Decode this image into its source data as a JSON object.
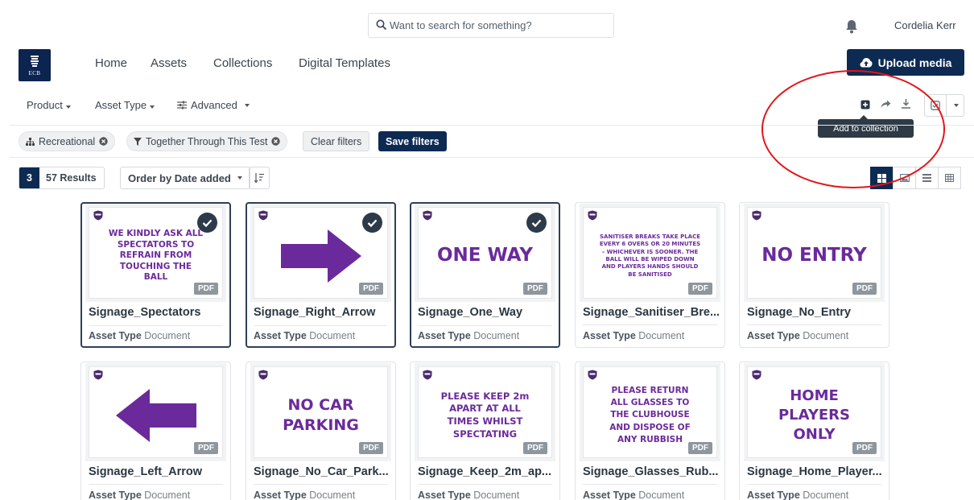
{
  "header": {
    "search_placeholder": "Want to search for something?",
    "user_name": "Cordelia Kerr"
  },
  "logo": {
    "text": "ECB"
  },
  "nav": {
    "items": [
      "Home",
      "Assets",
      "Collections",
      "Digital Templates"
    ]
  },
  "upload_button": "Upload media",
  "filters_bar": {
    "product": "Product",
    "asset_type": "Asset Type",
    "advanced": "Advanced"
  },
  "toolbar": {
    "tooltip": "Add to collection"
  },
  "chips": {
    "recreational": "Recreational",
    "campaign": "Together Through This Test"
  },
  "clear_filters": "Clear filters",
  "save_filters": "Save filters",
  "results": {
    "selected_count": "3",
    "results_label": "57 Results"
  },
  "order_by": "Order by Date added",
  "asset_type_label": "Asset Type",
  "pdf_label": "PDF",
  "accent_color": "#0d2a53",
  "sign_color": "#6b2a9b",
  "cards": [
    {
      "title": "Signage_Spectators",
      "type": "Document",
      "selected": true,
      "sign": "WE KINDLY ASK ALL SPECTATORS TO REFRAIN FROM TOUCHING THE BALL"
    },
    {
      "title": "Signage_Right_Arrow",
      "type": "Document",
      "selected": true,
      "sign": ""
    },
    {
      "title": "Signage_One_Way",
      "type": "Document",
      "selected": true,
      "sign": "ONE WAY"
    },
    {
      "title": "Signage_Sanitiser_Bre...",
      "type": "Document",
      "selected": false,
      "sign": "SANITISER BREAKS TAKE PLACE EVERY 6 OVERS OR 20 MINUTES – WHICHEVER IS SOONER. THE BALL WILL BE WIPED DOWN AND PLAYERS HANDS SHOULD BE SANITISED"
    },
    {
      "title": "Signage_No_Entry",
      "type": "Document",
      "selected": false,
      "sign": "NO ENTRY"
    },
    {
      "title": "Signage_Left_Arrow",
      "type": "Document",
      "selected": false,
      "sign": ""
    },
    {
      "title": "Signage_No_Car_Park...",
      "type": "Document",
      "selected": false,
      "sign": "NO CAR PARKING"
    },
    {
      "title": "Signage_Keep_2m_ap...",
      "type": "Document",
      "selected": false,
      "sign": "PLEASE KEEP 2m APART AT ALL TIMES WHILST SPECTATING"
    },
    {
      "title": "Signage_Glasses_Rub...",
      "type": "Document",
      "selected": false,
      "sign": "PLEASE RETURN ALL GLASSES TO THE CLUBHOUSE AND DISPOSE OF ANY RUBBISH"
    },
    {
      "title": "Signage_Home_Player...",
      "type": "Document",
      "selected": false,
      "sign": "HOME PLAYERS ONLY"
    }
  ]
}
